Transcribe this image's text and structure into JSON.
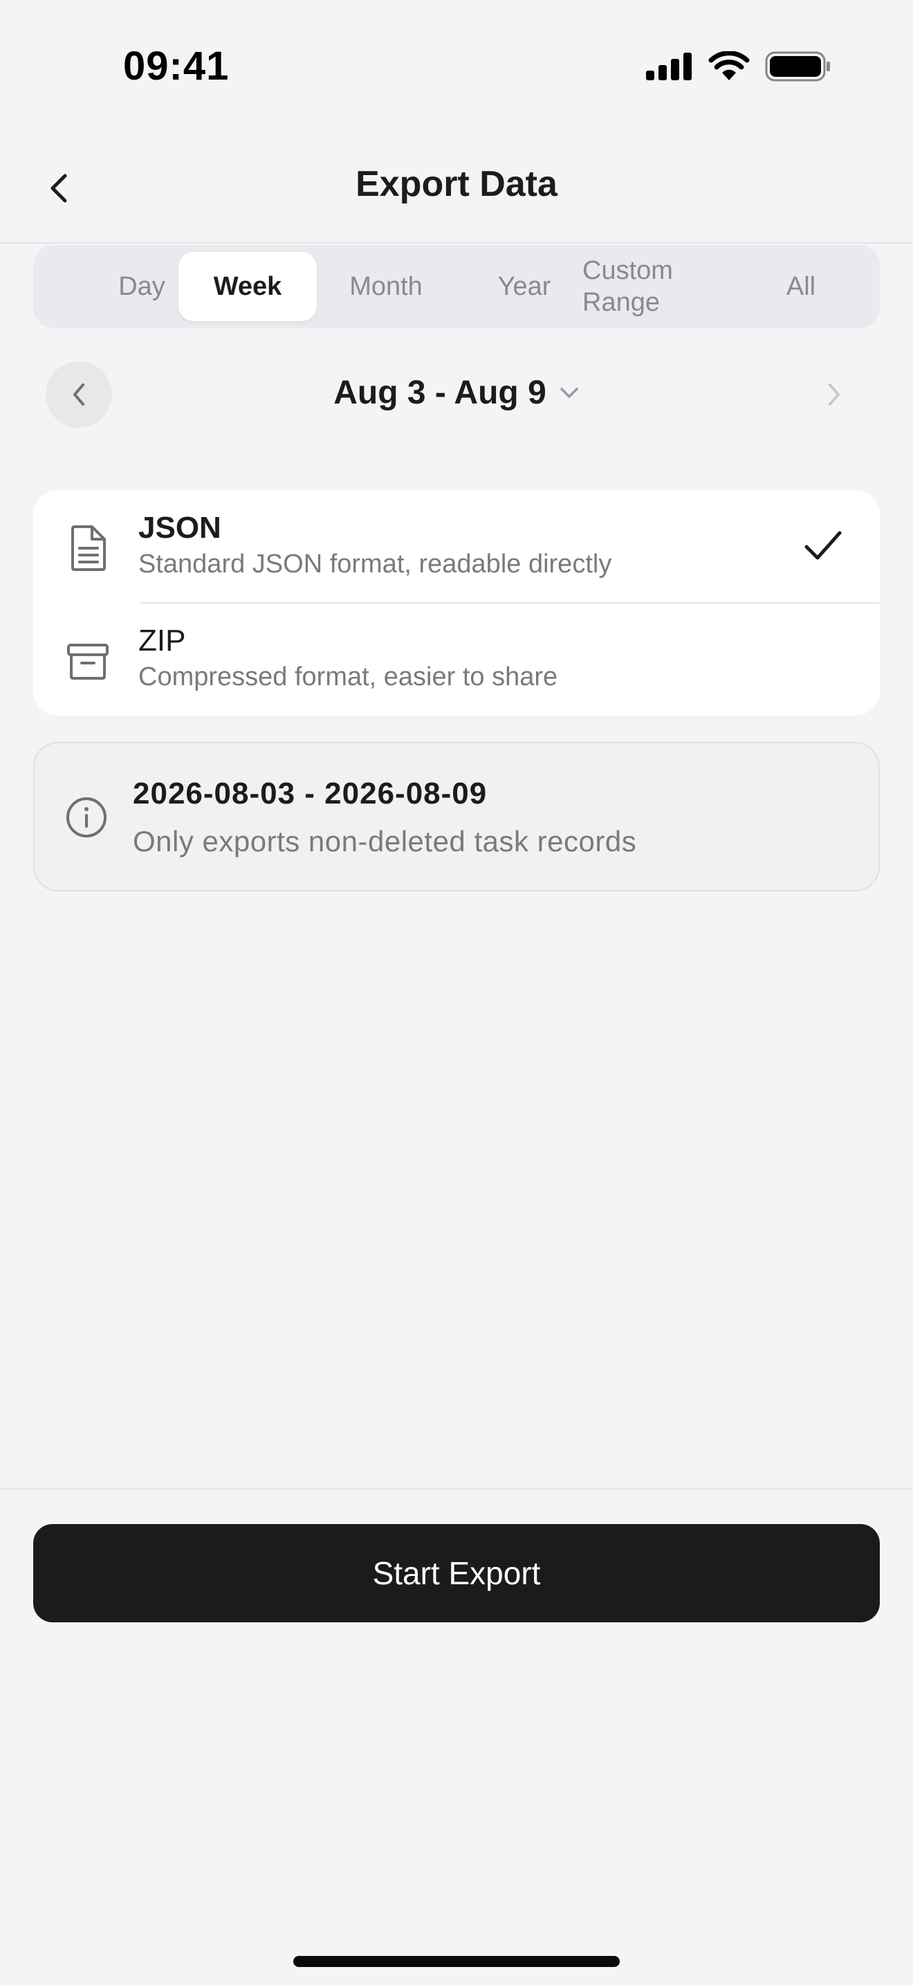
{
  "status_bar": {
    "time": "09:41"
  },
  "nav": {
    "title": "Export Data"
  },
  "segments": [
    {
      "label": "Day"
    },
    {
      "label": "Week"
    },
    {
      "label": "Month"
    },
    {
      "label": "Year"
    },
    {
      "label": "Custom Range"
    },
    {
      "label": "All"
    }
  ],
  "selected_segment": "Week",
  "date_nav": {
    "label": "Aug 3 - Aug 9"
  },
  "formats": [
    {
      "title": "JSON",
      "description": "Standard JSON format, readable directly",
      "selected": true
    },
    {
      "title": "ZIP",
      "description": "Compressed format, easier to share",
      "selected": false
    }
  ],
  "info": {
    "range": "2026-08-03 - 2026-08-09",
    "note": "Only exports non-deleted task records"
  },
  "export_button": {
    "label": "Start Export"
  },
  "colors": {
    "background": "#F3F4F6",
    "primary_button": "#1B1B1D",
    "text_primary": "#1C1C1E",
    "text_secondary": "#7A7A7E"
  }
}
